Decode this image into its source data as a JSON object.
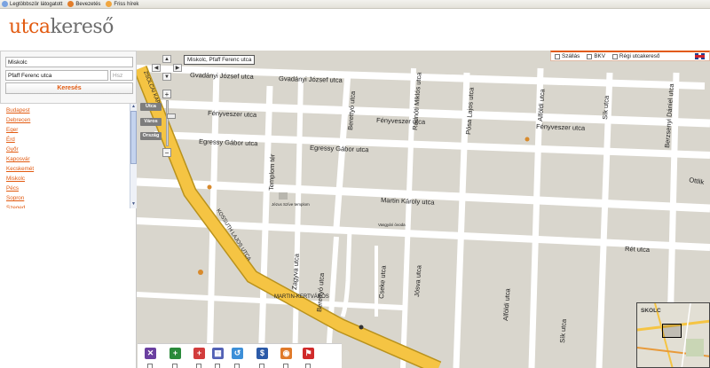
{
  "browser": {
    "bookmarks": [
      "Legtöbbször látogatott",
      "Bevezetés",
      "Friss hírek"
    ]
  },
  "site": {
    "logo_part1": "utca",
    "logo_part2": "kereső"
  },
  "search": {
    "city_value": "Miskolc",
    "street_value": "Pfaff Ferenc utca",
    "number_placeholder": "Hsz",
    "button_label": "Keresés"
  },
  "cities": [
    "Budapest",
    "Debrecen",
    "Eger",
    "Érd",
    "Győr",
    "Kaposvár",
    "Kecskemét",
    "Miskolc",
    "Pécs",
    "Sopron",
    "Szeged"
  ],
  "map_controls": {
    "tooltip": "Miskolc, Pfaff Ferenc utca",
    "level_utca": "Utca",
    "level_varos": "Város",
    "level_orszag": "Ország"
  },
  "layers": {
    "szallas": "Szállás",
    "bkv": "BKV",
    "regi": "Régi utcakereső"
  },
  "streets": {
    "gvadanyi1": "Gvadányi József utca",
    "gvadanyi2": "Gvadányi József utca",
    "fenyveszer1": "Fényveszer utca",
    "fenyveszer2": "Fényveszer utca",
    "fenyveszer3": "Fényveszer utca",
    "egressy1": "Egressy Gábor utca",
    "egressy2": "Egressy Gábor utca",
    "martin": "Martin Károly utca",
    "ret": "Rét utca",
    "templom": "Templom tér",
    "zsolcai": "ZSOLCAI KAPU",
    "kossuth": "KOSSUTH LAJOS UTCA",
    "zagyva": "Zagyva utca",
    "cseke": "Cseke utca",
    "josva": "Jósva utca",
    "beretyo1": "Berettyó utca",
    "beretyo2": "Berettyó utca",
    "radnoti": "Radnóti Miklós utca",
    "posa": "Pósa Lajos utca",
    "alfoldi1": "Alföldi utca",
    "alfoldi2": "Alföldi utca",
    "sik1": "Sík utca",
    "sik2": "Sík utca",
    "berzsenyi": "Berzsenyi Dániel utca",
    "ottlik": "Ottlik",
    "martinkertvaros": "MARTIN-KERTVÁROS",
    "church": "Jézus Szíve templom",
    "school": "Vasgyári óvoda",
    "minimap_label": "SKOLC"
  },
  "poi_icons": [
    "restaurant-icon",
    "pharmacy-icon",
    "hospital-icon",
    "hotel-icon",
    "parking-icon",
    "bank-icon",
    "fuel-icon",
    "school-icon"
  ],
  "colors": {
    "brand": "#e25a10",
    "main_road": "#f5c443",
    "block": "#d9d6cd",
    "street": "#ffffff"
  }
}
